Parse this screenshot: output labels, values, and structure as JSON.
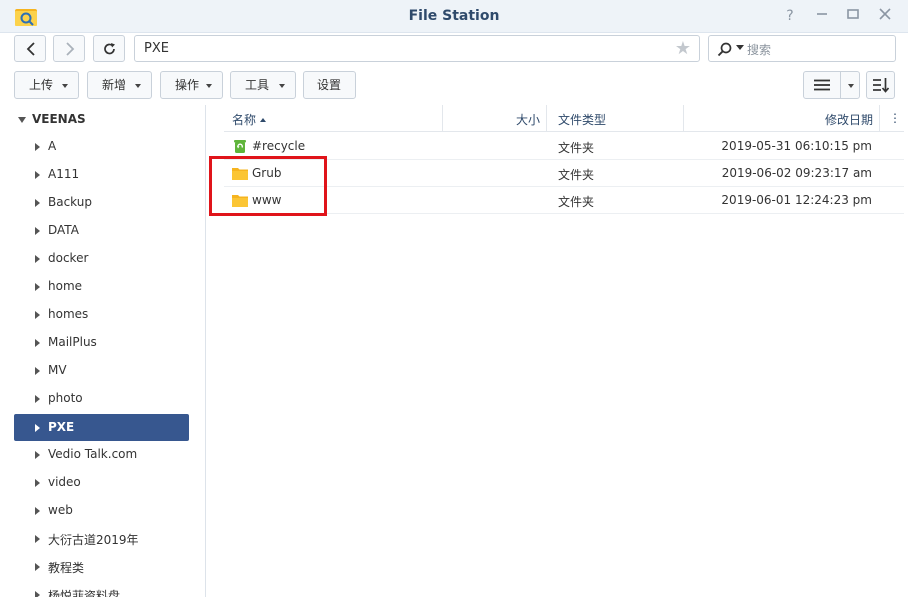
{
  "window": {
    "title": "File Station"
  },
  "toolbar": {
    "path": "PXE",
    "search_placeholder": "搜索",
    "upload": "上传",
    "new": "新增",
    "action": "操作",
    "tools": "工具",
    "settings": "设置"
  },
  "sidebar": {
    "root": "VEENAS",
    "items": [
      {
        "label": "A"
      },
      {
        "label": "A111"
      },
      {
        "label": "Backup"
      },
      {
        "label": "DATA"
      },
      {
        "label": "docker"
      },
      {
        "label": "home"
      },
      {
        "label": "homes"
      },
      {
        "label": "MailPlus"
      },
      {
        "label": "MV"
      },
      {
        "label": "photo"
      },
      {
        "label": "PXE"
      },
      {
        "label": "Vedio Talk.com"
      },
      {
        "label": "video"
      },
      {
        "label": "web"
      },
      {
        "label": "大衍古道2019年"
      },
      {
        "label": "教程类"
      },
      {
        "label": "杨悦菲资料盘"
      }
    ],
    "selected": "PXE"
  },
  "table": {
    "headers": {
      "name": "名称",
      "size": "大小",
      "type": "文件类型",
      "modified": "修改日期"
    },
    "rows": [
      {
        "name": "#recycle",
        "type": "文件夹",
        "modified": "2019-05-31 06:10:15 pm",
        "icon": "recycle-icon"
      },
      {
        "name": "Grub",
        "type": "文件夹",
        "modified": "2019-06-02 09:23:17 am",
        "icon": "folder-icon"
      },
      {
        "name": "www",
        "type": "文件夹",
        "modified": "2019-06-01 12:24:23 pm",
        "icon": "folder-icon"
      }
    ]
  },
  "colors": {
    "accent": "#37578f",
    "title": "#2f4a6b",
    "folder": "#f6b41f",
    "highlight": "#e0141a"
  }
}
